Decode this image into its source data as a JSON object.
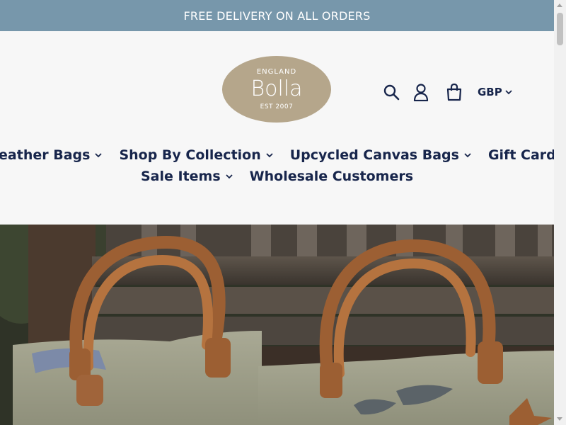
{
  "announcement": "FREE DELIVERY ON ALL ORDERS",
  "brand": {
    "top": "ENGLAND",
    "name": "Bolla",
    "bottom": "EST 2007",
    "color": "#b5a68b"
  },
  "header_icons": [
    "search-icon",
    "account-icon",
    "cart-icon"
  ],
  "currency": {
    "selected": "GBP"
  },
  "nav": {
    "row1": [
      {
        "label": "Leather Bags",
        "dropdown": true
      },
      {
        "label": "Shop By Collection",
        "dropdown": true
      },
      {
        "label": "Upcycled Canvas Bags",
        "dropdown": true
      },
      {
        "label": "Gift Cards",
        "dropdown": false
      }
    ],
    "row2": [
      {
        "label": "Sale Items",
        "dropdown": true
      },
      {
        "label": "Wholesale Customers",
        "dropdown": false
      }
    ]
  },
  "colors": {
    "announcement_bg": "#7797ab",
    "nav_text": "#17254b",
    "page_bg": "#f7f7f7"
  }
}
